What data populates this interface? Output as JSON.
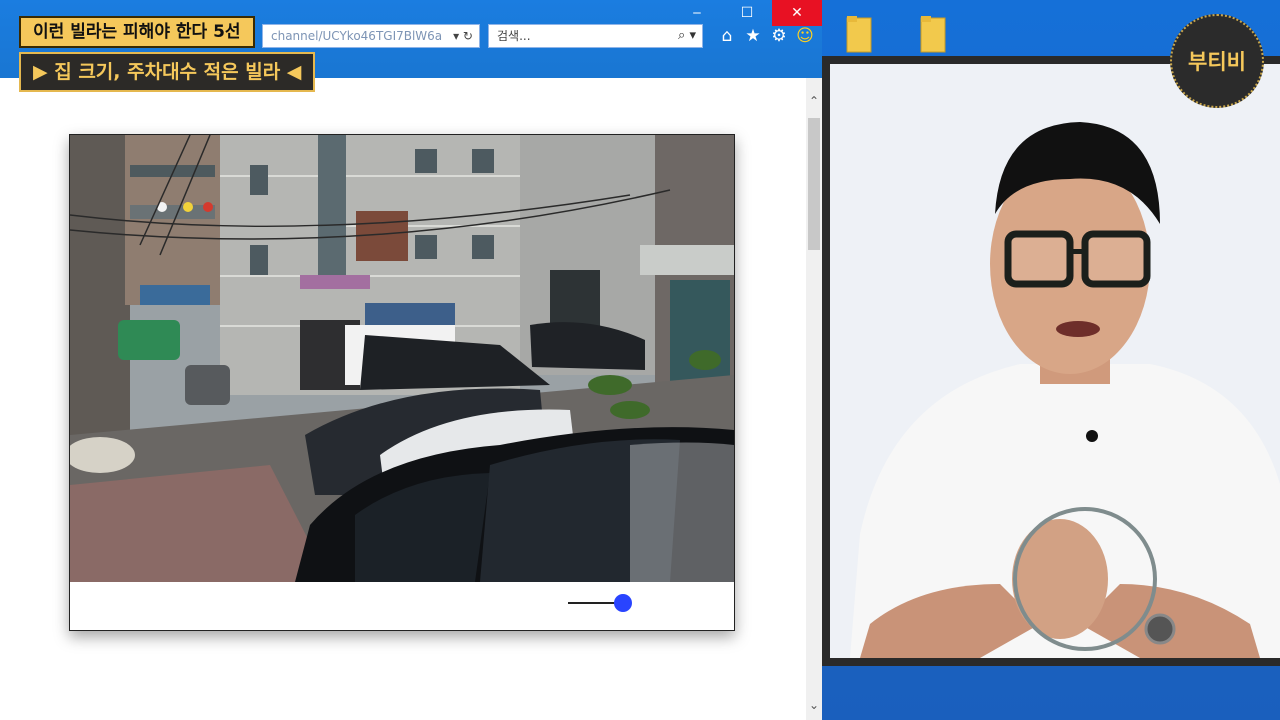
{
  "overlay": {
    "title_line1": "이런 빌라는 피해야 한다 5선",
    "title_line2": "▶ 집 크기, 주차대수 적은 빌라 ◀"
  },
  "browser": {
    "address_text": "channel/UCYko46TGI7BlW6a",
    "address_tools": "▾ ↻",
    "search_placeholder": "검색...",
    "search_tools": "⌕ ▾",
    "window_buttons": [
      "‒",
      "☐",
      "✕"
    ],
    "nav_icons": [
      "home-icon",
      "star-icon",
      "gear-icon",
      "smiley-icon"
    ],
    "nav_glyphs": [
      "⌂",
      "★",
      "⚙",
      "☺"
    ],
    "scroll_up": "⌃",
    "scroll_down": "⌄"
  },
  "photo_card": {
    "slider_value": 1.0
  },
  "channel_logo": {
    "text": "부티비"
  },
  "colors": {
    "titlebar": "#1976d2",
    "close_button": "#e81123",
    "title1_bg": "#f5c85b",
    "title2_bg": "#2c2a27",
    "slider_knob": "#2944ff",
    "logo_bg": "#2b2b2b"
  }
}
